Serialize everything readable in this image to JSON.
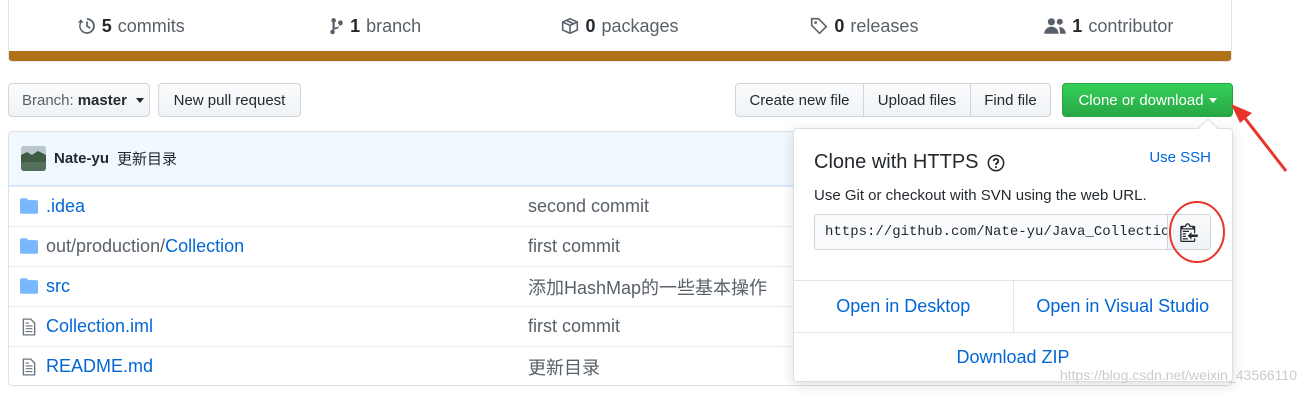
{
  "summary": {
    "commits": {
      "count": "5",
      "label": "commits"
    },
    "branches": {
      "count": "1",
      "label": "branch"
    },
    "packages": {
      "count": "0",
      "label": "packages"
    },
    "releases": {
      "count": "0",
      "label": "releases"
    },
    "contributors": {
      "count": "1",
      "label": "contributor"
    },
    "language_color": "#b07219"
  },
  "toolbar": {
    "branch_prefix": "Branch:",
    "branch_name": "master",
    "new_pr": "New pull request",
    "create_file": "Create new file",
    "upload_files": "Upload files",
    "find_file": "Find file",
    "clone": "Clone or download",
    "clone_color": "#28a745"
  },
  "commit": {
    "author": "Nate-yu",
    "message": "更新目录"
  },
  "files": [
    {
      "type": "folder",
      "name_muted": "",
      "name": ".idea",
      "message": "second commit"
    },
    {
      "type": "folder",
      "name_muted": "out/production/",
      "name": "Collection",
      "message": "first commit"
    },
    {
      "type": "folder",
      "name_muted": "",
      "name": "src",
      "message": "添加HashMap的一些基本操作"
    },
    {
      "type": "file",
      "name_muted": "",
      "name": "Collection.iml",
      "message": "first commit"
    },
    {
      "type": "file",
      "name_muted": "",
      "name": "README.md",
      "message": "更新目录"
    }
  ],
  "clone_popover": {
    "title": "Clone with HTTPS",
    "use_ssh": "Use SSH",
    "description": "Use Git or checkout with SVN using the web URL.",
    "url": "https://github.com/Nate-yu/Java_Collection.git",
    "open_desktop": "Open in Desktop",
    "open_vs": "Open in Visual Studio",
    "download_zip": "Download ZIP"
  },
  "watermark": "https://blog.csdn.net/weixin_43566110",
  "annotation_color": "#e8352b"
}
